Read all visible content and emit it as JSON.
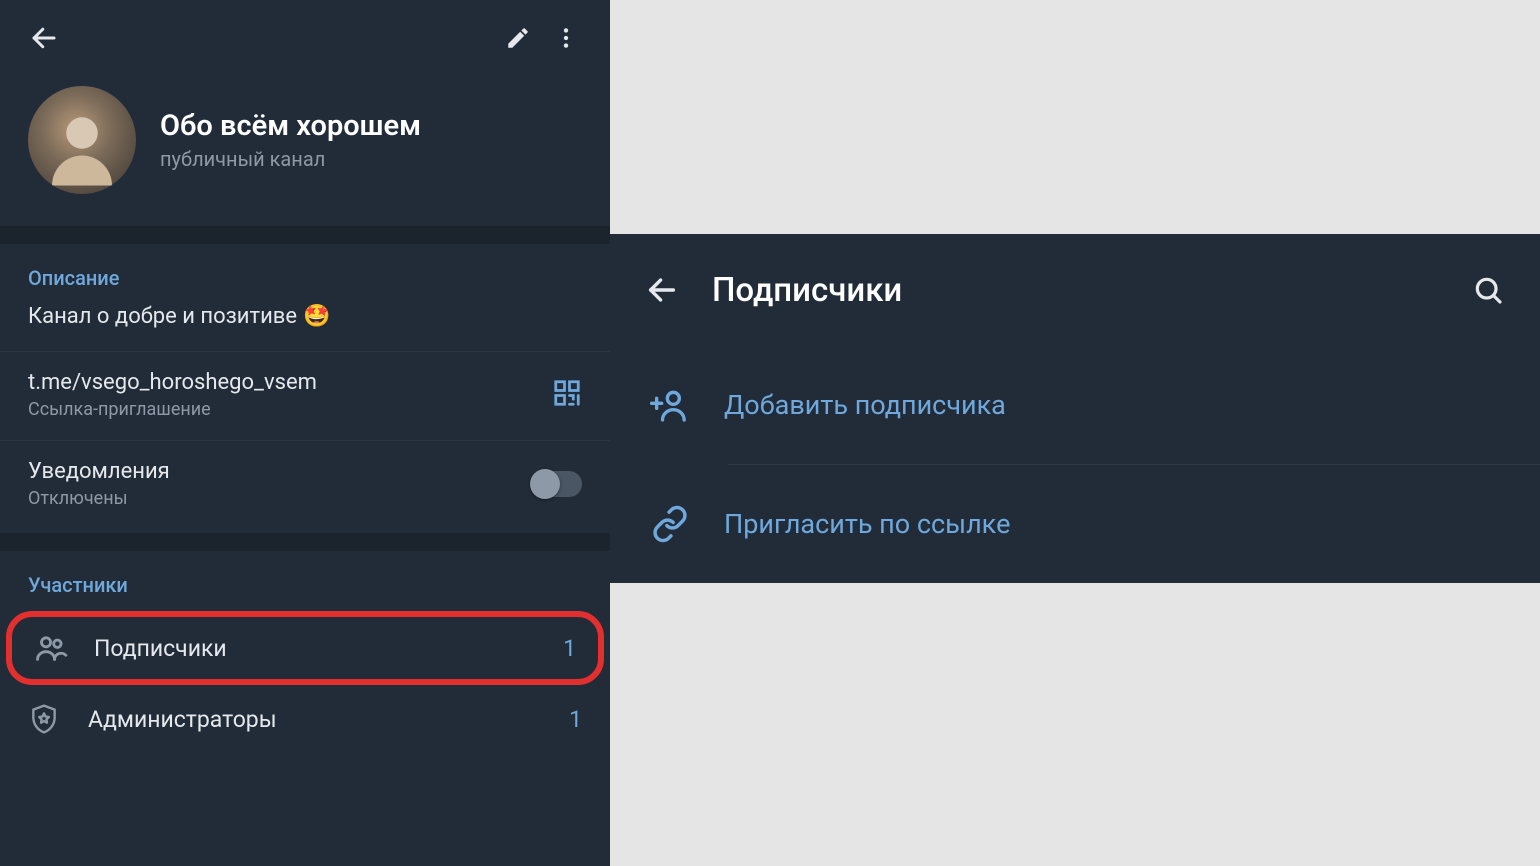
{
  "left": {
    "channel_name": "Обо всём хорошем",
    "channel_type": "публичный канал",
    "description": {
      "title": "Описание",
      "text": "Канал о добре и позитиве",
      "emoji": "🤩"
    },
    "invite": {
      "url": "t.me/vsego_horoshego_vsem",
      "caption": "Ссылка-приглашение"
    },
    "notifications": {
      "title": "Уведомления",
      "state": "Отключены"
    },
    "members": {
      "title": "Участники",
      "items": [
        {
          "label": "Подписчики",
          "count": "1"
        },
        {
          "label": "Администраторы",
          "count": "1"
        }
      ]
    }
  },
  "right": {
    "title": "Подписчики",
    "actions": [
      {
        "label": "Добавить подписчика"
      },
      {
        "label": "Пригласить по ссылке"
      }
    ]
  }
}
